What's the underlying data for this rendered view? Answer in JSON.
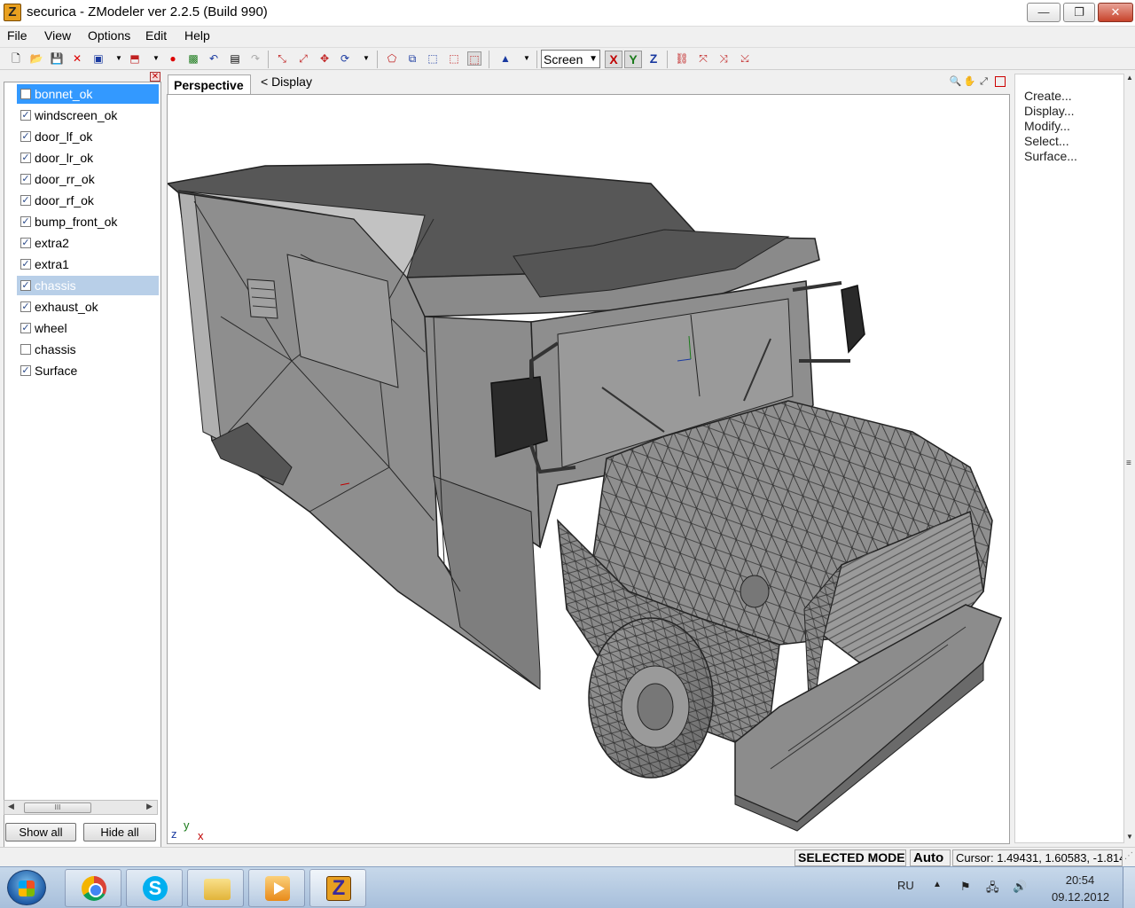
{
  "window": {
    "title": "securica - ZModeler ver 2.2.5 (Build 990)",
    "app_icon_letter": "Z",
    "min_glyph": "—",
    "max_glyph": "❐",
    "close_glyph": "✕"
  },
  "menu": [
    "File",
    "View",
    "Options",
    "Edit",
    "Help"
  ],
  "toolbar": {
    "view_select_value": "Screen",
    "axes": {
      "x": "X",
      "y": "Y",
      "z": "Z"
    },
    "axis_colors": {
      "x": "#c00000",
      "y": "#1a7a1a",
      "z": "#1a3aa0"
    }
  },
  "left_panel": {
    "objects": [
      {
        "name": "bonnet_ok",
        "checked": false,
        "state": "selected"
      },
      {
        "name": "windscreen_ok",
        "checked": true,
        "state": ""
      },
      {
        "name": "door_lf_ok",
        "checked": true,
        "state": ""
      },
      {
        "name": "door_lr_ok",
        "checked": true,
        "state": ""
      },
      {
        "name": "door_rr_ok",
        "checked": true,
        "state": ""
      },
      {
        "name": "door_rf_ok",
        "checked": true,
        "state": ""
      },
      {
        "name": "bump_front_ok",
        "checked": true,
        "state": ""
      },
      {
        "name": "extra2",
        "checked": true,
        "state": ""
      },
      {
        "name": "extra1",
        "checked": true,
        "state": ""
      },
      {
        "name": "chassis",
        "checked": true,
        "state": "hilite"
      },
      {
        "name": "exhaust_ok",
        "checked": true,
        "state": ""
      },
      {
        "name": "wheel",
        "checked": true,
        "state": ""
      },
      {
        "name": "chassis",
        "checked": false,
        "state": ""
      },
      {
        "name": "Surface",
        "checked": true,
        "state": ""
      }
    ],
    "scroll_thumb": "III",
    "show_all_label": "Show all",
    "hide_all_label": "Hide all"
  },
  "viewport": {
    "tab_label": "Perspective",
    "display_label": "<  Display",
    "axis_gizmo": {
      "x": "x",
      "y": "y",
      "z": "z"
    }
  },
  "right_panel": {
    "items": [
      "Create...",
      "Display...",
      "Modify...",
      "Select...",
      "Surface..."
    ]
  },
  "status": {
    "mode": "SELECTED MODE",
    "auto": "Auto",
    "cursor": "Cursor: 1.49431, 1.60583, -1.814"
  },
  "taskbar": {
    "language": "RU",
    "time": "20:54",
    "date": "09.12.2012",
    "skype_letter": "S",
    "zmodeler_letter": "Z"
  }
}
